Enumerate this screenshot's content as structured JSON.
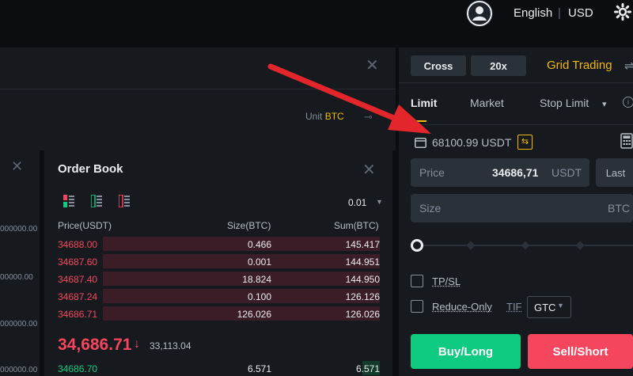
{
  "header": {
    "language": "English",
    "separator": "|",
    "currency": "USD",
    "icons": [
      "user-icon",
      "gear-icon"
    ]
  },
  "chart_panel": {
    "close_glyph": "✕",
    "unit_label": "Unit",
    "unit_value": "BTC"
  },
  "left_sliver": {
    "close_glyph": "✕",
    "values": [
      "000000.00",
      "00000.00",
      "000000.00",
      "000000.00"
    ]
  },
  "order_book": {
    "title": "Order Book",
    "close_glyph": "✕",
    "precision": "0.01",
    "columns": [
      "Price(USDT)",
      "Size(BTC)",
      "Sum(BTC)"
    ],
    "asks": [
      {
        "price": "34688.00",
        "size": "0.466",
        "sum": "145.417",
        "depth": 0.86
      },
      {
        "price": "34687.60",
        "size": "0.001",
        "sum": "144.951",
        "depth": 0.86
      },
      {
        "price": "34687.40",
        "size": "18.824",
        "sum": "144.950",
        "depth": 0.86
      },
      {
        "price": "34687.24",
        "size": "0.100",
        "sum": "126.126",
        "depth": 0.86
      },
      {
        "price": "34686.71",
        "size": "126.026",
        "sum": "126.026",
        "depth": 0.86
      }
    ],
    "last_price": "34,686.71",
    "last_arrow": "↓",
    "mark_price": "33,113.04",
    "bids": [
      {
        "price": "34686.70",
        "size": "6.571",
        "sum": "6.571"
      }
    ]
  },
  "order_form": {
    "margin_mode": "Cross",
    "leverage": "20x",
    "grid_trading": "Grid Trading",
    "tabs": [
      "Limit",
      "Market",
      "Stop Limit"
    ],
    "active_tab": "Limit",
    "stop_limit_caret": "▾",
    "available": "68100.99 USDT",
    "transfer_glyph": "⇆",
    "price_label": "Price",
    "price_value": "34686,71",
    "price_unit": "USDT",
    "last_button": "Last",
    "size_label": "Size",
    "size_unit": "BTC",
    "slider_percent": 0,
    "tp_sl": "TP/SL",
    "reduce_only": "Reduce-Only",
    "tif_label": "TIF",
    "tif_value": "GTC",
    "buy_label": "Buy/Long",
    "sell_label": "Sell/Short",
    "colors": {
      "buy": "#0ecb81",
      "sell": "#f6465d",
      "accent": "#f0b90b",
      "annotation": "#e3262b"
    }
  }
}
